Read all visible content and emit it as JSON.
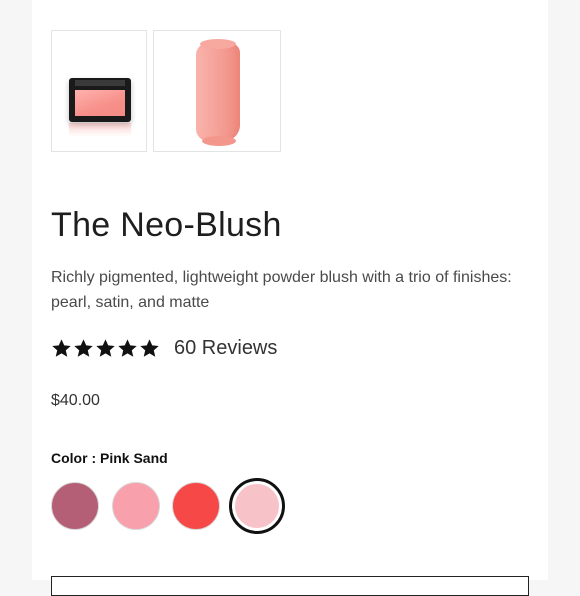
{
  "product": {
    "title": "The Neo-Blush",
    "description": "Richly pigmented, lightweight powder blush with a trio of finishes: pearl, satin, and matte",
    "rating": 5,
    "reviews_label": "60 Reviews",
    "price": "$40.00"
  },
  "thumbnails": [
    {
      "name": "compact-image",
      "icon": "blush-compact"
    },
    {
      "name": "swatch-image",
      "icon": "blush-texture-swatch"
    }
  ],
  "color": {
    "label": "Color : Pink Sand",
    "swatches": [
      {
        "color": "#b55f77",
        "selected": false
      },
      {
        "color": "#f8a0ab",
        "selected": false
      },
      {
        "color": "#f64846",
        "selected": false
      },
      {
        "color": "#f8c3c8",
        "selected": true
      }
    ]
  },
  "colors": {
    "star": "#111111",
    "text": "#1e1e1e",
    "page_bg": "#f6f6f6"
  }
}
